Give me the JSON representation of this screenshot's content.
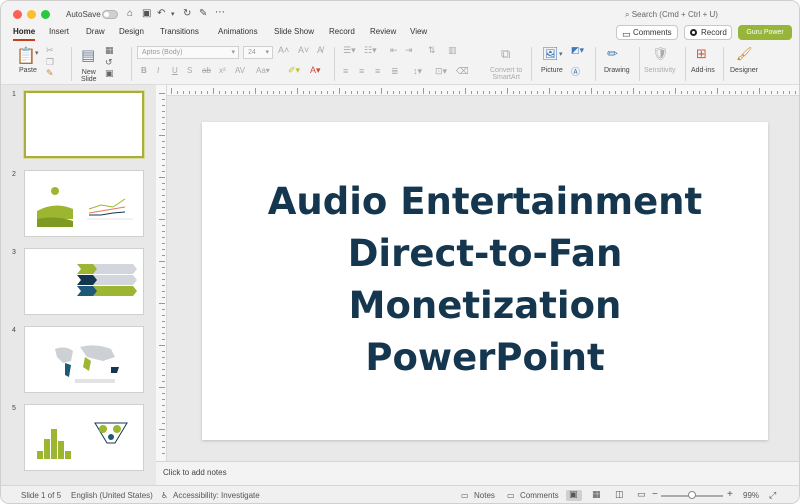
{
  "titlebar": {
    "autosave_label": "AutoSave",
    "search_placeholder": "Search (Cmd + Ctrl + U)"
  },
  "menu": {
    "tabs": [
      "Home",
      "Insert",
      "Draw",
      "Design",
      "Transitions",
      "Animations",
      "Slide Show",
      "Record",
      "Review",
      "View"
    ],
    "active_tab": "Home",
    "comments_label": "Comments",
    "record_label": "Record",
    "guru_label": "Guru Power",
    "guru_color": "#96b53a",
    "accent_color": "#c43e1c"
  },
  "ribbon": {
    "paste_label": "Paste",
    "new_slide_label": "New\nSlide",
    "font_name": "Aptos (Body)",
    "font_size": "24",
    "convert_label": "Convert to\nSmartArt",
    "picture_label": "Picture",
    "drawing_label": "Drawing",
    "sensitivity_label": "Sensitivity",
    "addins_label": "Add-ins",
    "designer_label": "Designer"
  },
  "slides": {
    "numbers": [
      "1",
      "2",
      "3",
      "4",
      "5"
    ],
    "selected": "1"
  },
  "slide": {
    "title_lines": [
      "Audio Entertainment",
      "Direct-to-Fan",
      "Monetization",
      "PowerPoint"
    ],
    "title_color": "#14364e"
  },
  "notes": {
    "placeholder": "Click to add notes"
  },
  "status": {
    "slide_counter": "Slide 1 of 5",
    "language": "English (United States)",
    "accessibility": "Accessibility: Investigate",
    "notes_label": "Notes",
    "comments_label": "Comments",
    "zoom": "99%"
  }
}
